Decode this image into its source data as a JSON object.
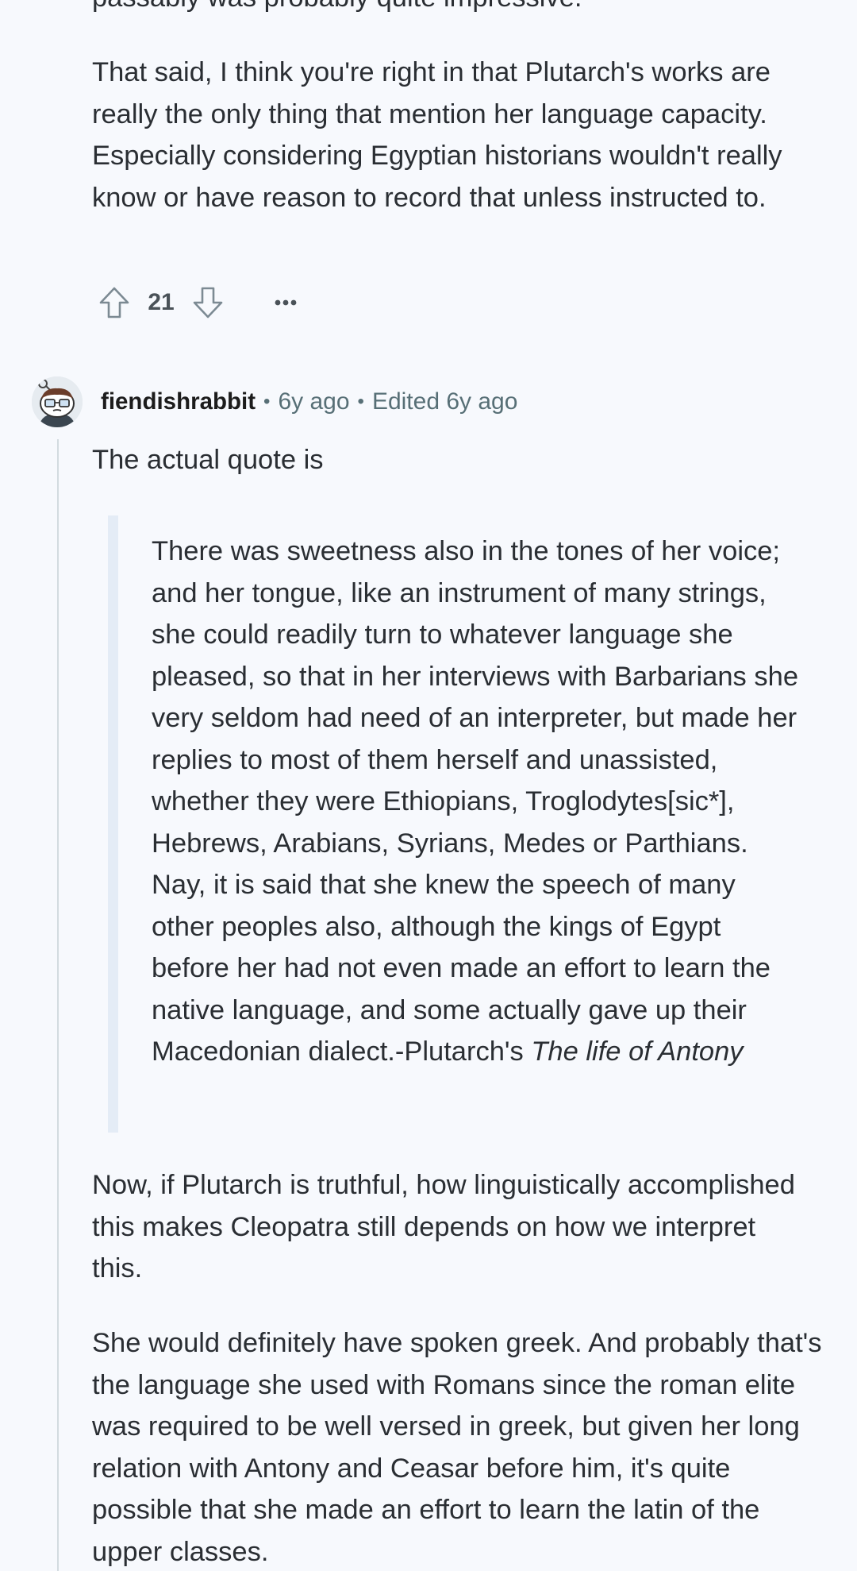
{
  "previous_comment": {
    "tail_text": "passably was probably quite impressive.",
    "paragraph": "That said, I think you're right in that Plutarch's works are really the only thing that mention her language capacity. Especially considering Egyptian historians wouldn't really know or have reason to record that unless instructed to.",
    "vote_count": "21",
    "upvote_icon": "arrow-up-outline-icon",
    "downvote_icon": "arrow-down-outline-icon",
    "more_icon": "ellipsis-icon"
  },
  "comment": {
    "author": "fiendishrabbit",
    "separator": "•",
    "time": "6y ago",
    "edited": "Edited 6y ago",
    "intro": "The actual quote is",
    "quote_main": "There was sweetness also in the tones of her voice; and her tongue, like an instrument of many strings, she could readily turn to whatever language she pleased, so that in her interviews with Barbarians she very seldom had need of an interpreter, but made her replies to most of them herself and unassisted, whether they were Ethiopians, Troglodytes[sic*], Hebrews, Arabians, Syrians, Medes or Parthians. Nay, it is said that she knew the speech of many other peoples also, although the kings of Egypt before her had not even made an effort to learn the native language, and some actually gave up their Macedonian dialect.-Plutarch's ",
    "quote_source": "The life of Antony",
    "paragraph_2": "Now, if Plutarch is truthful, how linguistically accomplished this makes Cleopatra still depends on how we interpret this.",
    "paragraph_3": "She would definitely have spoken greek. And probably that's the language she used with Romans since the roman elite was required to be well versed in greek, but given her long relation with Antony and Ceasar before him, it's quite possible that she made an effort to learn the latin of the upper classes."
  },
  "colors": {
    "background": "#f7f9fd",
    "text": "#2a2e33",
    "meta": "#576f76",
    "quote_bar": "#e4ecf6",
    "thread_line": "#d3dbe0"
  }
}
